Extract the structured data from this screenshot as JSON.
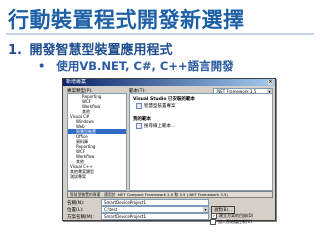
{
  "slide": {
    "title": "行動裝置程式開發新選擇",
    "bullet1_num": "1.",
    "bullet1": "開發智慧型裝置應用程式",
    "bullet2_dot": "•",
    "bullet2": "使用VB.NET, C#, C++語言開發"
  },
  "dialog": {
    "title": "新增專案",
    "close": "×",
    "project_types_label": "專案類型(P):",
    "templates_label": "範本(T):",
    "framework": ".NET Framework 3.5",
    "tree": [
      {
        "label": "Reporting",
        "depth": 3,
        "selected": false
      },
      {
        "label": "WCF",
        "depth": 3,
        "selected": false
      },
      {
        "label": "Workflow",
        "depth": 3,
        "selected": false
      },
      {
        "label": "其他",
        "depth": 3,
        "selected": false
      },
      {
        "label": "Visual C#",
        "depth": 1,
        "selected": false
      },
      {
        "label": "Windows",
        "depth": 2,
        "selected": false
      },
      {
        "label": "Web",
        "depth": 2,
        "selected": false
      },
      {
        "label": "智慧型裝置",
        "depth": 2,
        "selected": true
      },
      {
        "label": "Office",
        "depth": 2,
        "selected": false
      },
      {
        "label": "資料庫",
        "depth": 2,
        "selected": false
      },
      {
        "label": "Reporting",
        "depth": 2,
        "selected": false
      },
      {
        "label": "WCF",
        "depth": 2,
        "selected": false
      },
      {
        "label": "Workflow",
        "depth": 2,
        "selected": false
      },
      {
        "label": "其他",
        "depth": 2,
        "selected": false
      },
      {
        "label": "Visual C++",
        "depth": 1,
        "selected": false
      },
      {
        "label": "其他專案類型",
        "depth": 1,
        "selected": false
      },
      {
        "label": "測試專案",
        "depth": 1,
        "selected": false
      }
    ],
    "templates_section1": "Visual Studio 已安裝的範本",
    "template_item1": "智慧型裝置專案",
    "templates_section2": "我的範本",
    "template_item2": "搜尋線上範本...",
    "description": "智慧型裝置的專案 - 適用於 .NET Compact Framework 2.0 和 3.5 (.NET Framework 3.5)",
    "name_label": "名稱(N):",
    "name_value": "SmartDeviceProject1",
    "location_label": "位置(L):",
    "location_value": "C:\\test",
    "solution_label": "方案名稱(M):",
    "solution_value": "SmartDeviceProject1",
    "browse": "瀏覽(B)...",
    "create_dir": "建立方案的目錄(D)",
    "create_dir_checked": "✓",
    "add_sc": "加入原始檔控制(U)",
    "ok": "確定",
    "cancel": "取消"
  }
}
